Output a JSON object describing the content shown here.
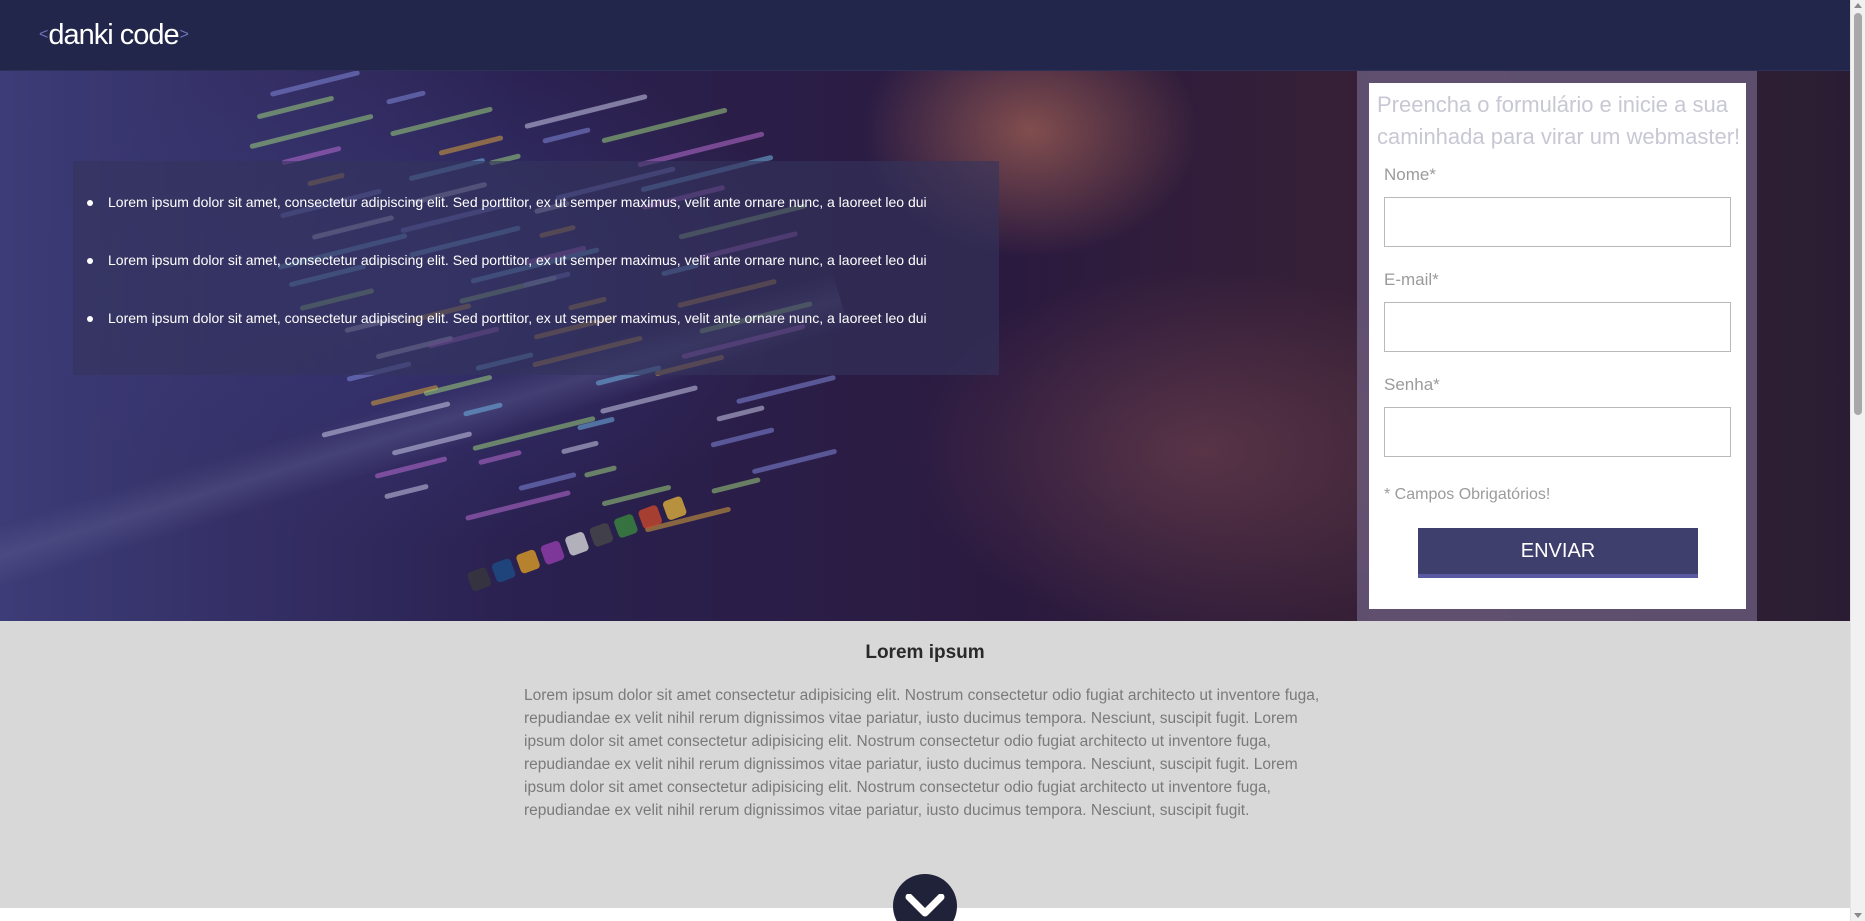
{
  "header": {
    "logo_text": "danki code",
    "logo_left": "<",
    "logo_right": ">"
  },
  "hero": {
    "features": [
      "Lorem ipsum dolor sit amet, consectetur adipiscing elit. Sed porttitor, ex ut semper maximus, velit ante ornare nunc, a laoreet leo dui",
      "Lorem ipsum dolor sit amet, consectetur adipiscing elit. Sed porttitor, ex ut semper maximus, velit ante ornare nunc, a laoreet leo dui",
      "Lorem ipsum dolor sit amet, consectetur adipiscing elit. Sed porttitor, ex ut semper maximus, velit ante ornare nunc, a laoreet leo dui"
    ]
  },
  "form": {
    "title": "Preencha o formulário e inicie a sua caminhada para virar um webmaster!",
    "name_label": "Nome*",
    "email_label": "E-mail*",
    "password_label": "Senha*",
    "name_value": "",
    "email_value": "",
    "password_value": "",
    "required_note": "* Campos Obrigatórios!",
    "submit_label": "ENVIAR"
  },
  "info": {
    "title": "Lorem ipsum",
    "text": "Lorem ipsum dolor sit amet consectetur adipisicing elit. Nostrum consectetur odio fugiat architecto ut inventore fuga, repudiandae ex velit nihil rerum dignissimos vitae pariatur, iusto ducimus tempora. Nesciunt, suscipit fugit. Lorem ipsum dolor sit amet consectetur adipisicing elit. Nostrum consectetur odio fugiat architecto ut inventore fuga, repudiandae ex velit nihil rerum dignissimos vitae pariatur, iusto ducimus tempora. Nesciunt, suscipit fugit. Lorem ipsum dolor sit amet consectetur adipisicing elit. Nostrum consectetur odio fugiat architecto ut inventore fuga, repudiandae ex velit nihil rerum dignissimos vitae pariatur, iusto ducimus tempora. Nesciunt, suscipit fugit."
  },
  "icons": {
    "scroll_down": "chevron-down-icon"
  },
  "colors": {
    "header_bg": "#22264a",
    "button_bg": "#3f3f6e",
    "button_accent": "#5a5aa3",
    "info_bg": "#d8d8d8"
  }
}
